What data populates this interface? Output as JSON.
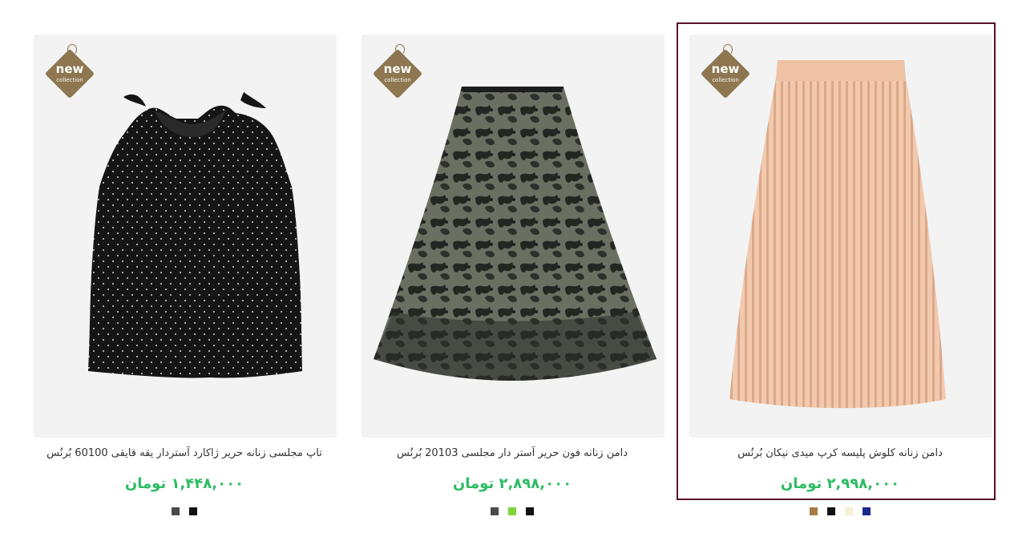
{
  "badge": {
    "line1": "new",
    "line2": "collection"
  },
  "products": [
    {
      "title": "تاپ مجلسی زنانه حریر ژاکارد آستردار یقه قایقی 60100 بُرنُس",
      "price": "۱,۴۴۸,۰۰۰ تومان",
      "colors": [
        "#4a4a4a",
        "#111111"
      ]
    },
    {
      "title": "دامن زنانه فون حریر آستر دار مجلسی 20103 بُرنُس",
      "price": "۲,۸۹۸,۰۰۰ تومان",
      "colors": [
        "#4a4a4a",
        "#7fd43a",
        "#111111"
      ]
    },
    {
      "title": "دامن زنانه کلوش پلیسه کرپ میدی نیکان بُرنُس",
      "price": "۲,۹۹۸,۰۰۰ تومان",
      "colors": [
        "#a87b45",
        "#111111",
        "#f6eed2",
        "#1a2a8c"
      ]
    }
  ]
}
